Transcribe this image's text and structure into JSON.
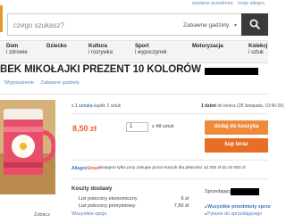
{
  "header": {
    "util_links": [
      "wysłane przedmiot",
      "moje allegro"
    ],
    "search_placeholder": "czego szukasz?",
    "search_category": "Zabawne gadżety"
  },
  "categories": [
    {
      "line1": "Dom",
      "line2": "i zdrowie"
    },
    {
      "line1": "Dziecko",
      "line2": ""
    },
    {
      "line1": "Kultura",
      "line2": "i rozrywka"
    },
    {
      "line1": "Sport",
      "line2": "i wypoczynek"
    },
    {
      "line1": "Motoryzacja",
      "line2": ""
    },
    {
      "line1": "Kolekcj",
      "line2": "i sztuk"
    }
  ],
  "listing": {
    "title": "BEK MIKOŁAJKI PREZENT 10 KOLORÓW",
    "breadcrumbs": [
      "Wyposażenie",
      "Zabawne gadżety"
    ]
  },
  "offer": {
    "stock_prefix": "z",
    "stock_count": "1 sztuka",
    "stock_suffix": "kupiło 2 sztuk",
    "ends_strong": "1 dzień",
    "ends_rest": "do końca (28 listopada, 10:40:26)",
    "price": "8,50 zł",
    "quantity": "1",
    "quantity_note": "z 48 sztuk",
    "add_to_cart": "dodaj do koszyka",
    "buy_now": "kup teraz",
    "promo_logo_a": "Allegro",
    "promo_logo_b": "Smart",
    "promo_text": "dostępne tylko przy zakupie przez koszyk dla płatności od 300 zł do 20 000 zł",
    "thumb_label": "Zobacz"
  },
  "shipping": {
    "heading": "Koszty dostawy",
    "rows": [
      {
        "label": "List polecony ekonomiczny",
        "price": "6 zł"
      },
      {
        "label": "List polecony priorytetowy",
        "price": "7,50 zł"
      }
    ],
    "more": "Wszystkie opcje"
  },
  "seller": {
    "heading": "Sprzedający",
    "links": [
      "Wszystkie przedmioty sprze",
      "Pytanie do sprzedającego"
    ]
  },
  "colors": {
    "accent_orange": "#e8632c",
    "link_blue": "#4a7cc0",
    "search_button": "#3a3a3a"
  }
}
